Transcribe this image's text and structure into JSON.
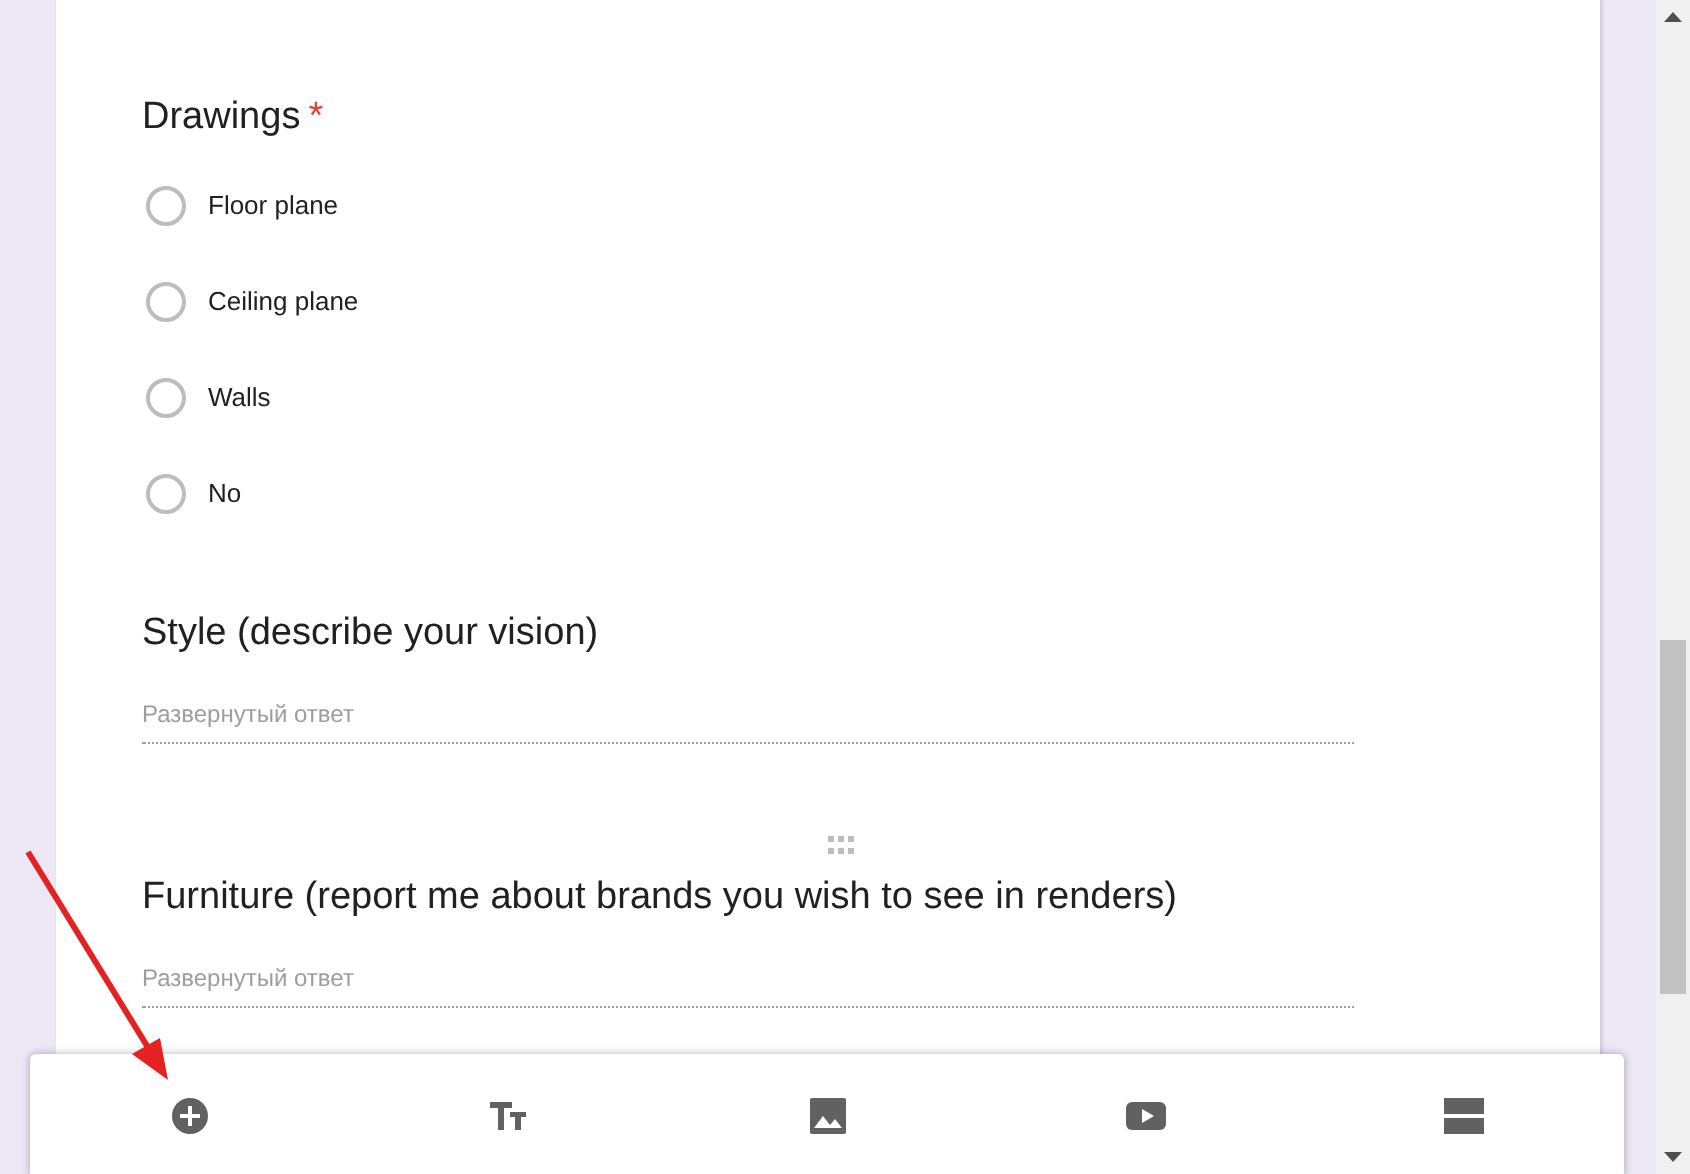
{
  "questions": [
    {
      "kind": "choice",
      "title": "Drawings",
      "required_mark": "*",
      "drag_handle": false,
      "options": [
        {
          "label": "Floor plane",
          "selected": false
        },
        {
          "label": "Ceiling plane",
          "selected": false
        },
        {
          "label": "Walls",
          "selected": false
        },
        {
          "label": "No",
          "selected": false
        }
      ]
    },
    {
      "kind": "paragraph",
      "title": "Style (describe your vision)",
      "drag_handle": false,
      "placeholder": "Развернутый ответ"
    },
    {
      "kind": "paragraph",
      "title": "Furniture (report me about brands you wish to see in renders)",
      "drag_handle": true,
      "placeholder": "Развернутый ответ"
    }
  ],
  "toolbar": [
    {
      "kind": "add"
    },
    {
      "kind": "title"
    },
    {
      "kind": "image"
    },
    {
      "kind": "video"
    },
    {
      "kind": "section"
    }
  ]
}
